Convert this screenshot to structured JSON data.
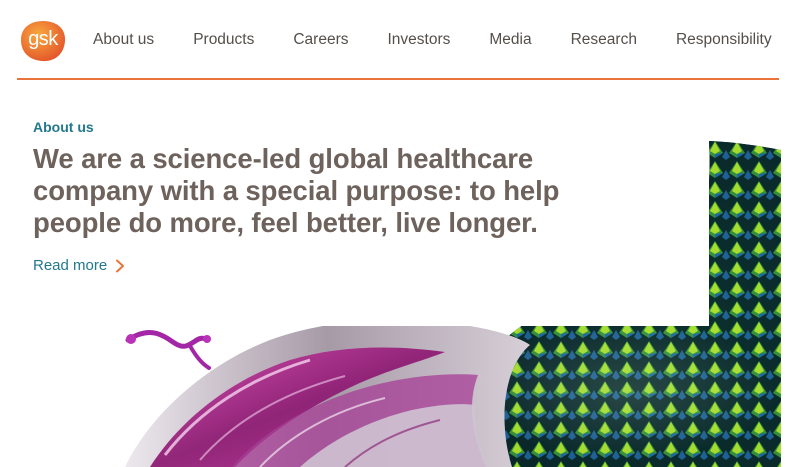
{
  "brand": {
    "logo_text": "gsk",
    "accent_color": "#e8743b",
    "logo_gradient": [
      "#f7a13a",
      "#e3542a"
    ]
  },
  "nav": {
    "items": [
      {
        "label": "About us"
      },
      {
        "label": "Products"
      },
      {
        "label": "Careers"
      },
      {
        "label": "Investors"
      },
      {
        "label": "Media"
      },
      {
        "label": "Research"
      },
      {
        "label": "Responsibility"
      }
    ]
  },
  "hero": {
    "eyebrow": "About us",
    "headline": "We are a science-led global healthcare company with a special purpose: to help people do more, feel better, live longer.",
    "cta_label": "Read more",
    "cta_icon": "chevron-right-icon",
    "eyebrow_color": "#23788c",
    "headline_color": "#6e625c",
    "image": "science-art-image"
  }
}
